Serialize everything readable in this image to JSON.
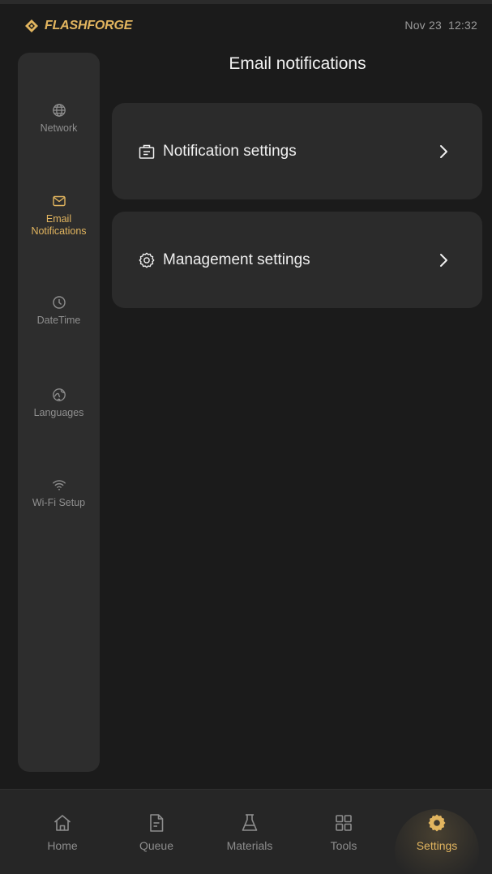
{
  "status_bar": {
    "brand": "FLASHFORGE",
    "date": "Nov 23",
    "time": "12:32"
  },
  "page": {
    "title": "Email notifications"
  },
  "sidebar": {
    "items": [
      {
        "label": "Network",
        "icon": "globe-icon",
        "active": false
      },
      {
        "label": "Email\nNotifications",
        "icon": "mail-icon",
        "active": true
      },
      {
        "label": "DateTime",
        "icon": "clock-icon",
        "active": false
      },
      {
        "label": "Languages",
        "icon": "language-icon",
        "active": false
      },
      {
        "label": "Wi-Fi Setup",
        "icon": "wifi-icon",
        "active": false
      }
    ]
  },
  "settings_list": [
    {
      "label": "Notification settings",
      "icon": "notification-settings-icon"
    },
    {
      "label": "Management settings",
      "icon": "gear-icon"
    }
  ],
  "bottom_nav": {
    "items": [
      {
        "label": "Home",
        "icon": "home-icon",
        "active": false
      },
      {
        "label": "Queue",
        "icon": "file-icon",
        "active": false
      },
      {
        "label": "Materials",
        "icon": "flask-icon",
        "active": false
      },
      {
        "label": "Tools",
        "icon": "grid-icon",
        "active": false
      },
      {
        "label": "Settings",
        "icon": "settings-gear-icon",
        "active": true
      }
    ]
  },
  "colors": {
    "accent": "#e2b55f",
    "background": "#1b1b1b",
    "card": "#2b2b2b",
    "sidebar": "#2d2d2d",
    "muted_text": "#8f8f8f"
  }
}
